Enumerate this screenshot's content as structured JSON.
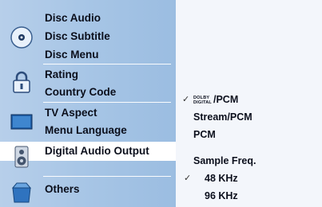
{
  "menu": {
    "items": [
      {
        "label": "Disc Audio"
      },
      {
        "label": "Disc Subtitle"
      },
      {
        "label": "Disc Menu"
      },
      {
        "label": "Rating"
      },
      {
        "label": "Country Code"
      },
      {
        "label": "TV Aspect"
      },
      {
        "label": "Menu Language"
      },
      {
        "label": "Digital Audio Output"
      },
      {
        "label": "Others"
      }
    ]
  },
  "panel": {
    "options": [
      {
        "label": "/PCM",
        "prefix_logo": "DOLBY DIGITAL",
        "checked": true
      },
      {
        "label": "Stream/PCM",
        "checked": false
      },
      {
        "label": "PCM",
        "checked": false
      },
      {
        "label": "Sample Freq.",
        "checked": false
      },
      {
        "label": "48 KHz",
        "checked": true
      },
      {
        "label": "96 KHz",
        "checked": false
      }
    ],
    "check_glyph": "✓"
  },
  "icons": [
    "disc-icon",
    "lock-icon",
    "tv-icon",
    "speaker-icon",
    "box-icon"
  ]
}
